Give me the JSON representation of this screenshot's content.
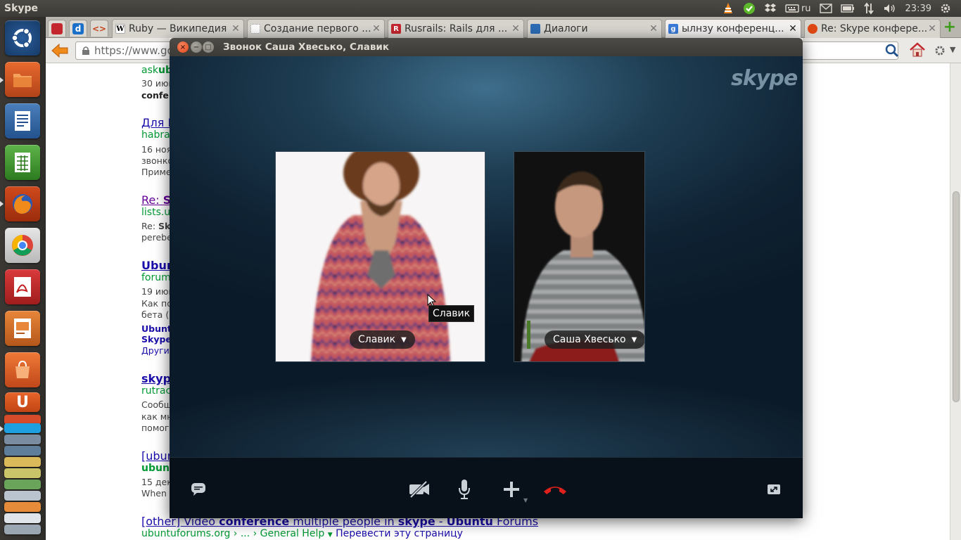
{
  "top_panel": {
    "app_title": "Skype",
    "keyboard_layout": "ru",
    "clock": "23:39"
  },
  "browser": {
    "tabs": [
      {
        "label": "Ruby — Википедия",
        "favicon": "wikipedia-icon"
      },
      {
        "label": "Создание первого ...",
        "favicon": "page-icon"
      },
      {
        "label": "Rusrails: Rails для ...",
        "favicon": "rusrails-icon"
      },
      {
        "label": "Диалоги",
        "favicon": "dialog-icon"
      },
      {
        "label": "ылнзу конференц...",
        "favicon": "google-icon",
        "active": true
      },
      {
        "label": "Re: Skype конфере...",
        "favicon": "ubuntu-icon"
      }
    ],
    "url": "https://www.goo"
  },
  "results": [
    {
      "title": "",
      "url_pre": "ask",
      "url_bold": "ub",
      "snippet": [
        "30 июн",
        "confe"
      ]
    },
    {
      "title": "Для L",
      "url": "habrah",
      "snippet": [
        "16 ноя",
        "звонко",
        "Приме"
      ]
    },
    {
      "title_pre": "Re: ",
      "title_bold": "S",
      "url": "lists.ub",
      "snippet_pre": "Re: ",
      "snippet_bold": "Sk",
      "snippet2": "perebe"
    },
    {
      "title": "Ubun",
      "url": "forum.",
      "snippet": [
        "19 июн",
        "Как по",
        "бета (2"
      ],
      "sub": [
        "Ubuntu",
        "Skype"
      ],
      "sub_link": "Другие"
    },
    {
      "title": "skype",
      "url": "rutrack",
      "snippet": [
        "Сообщ",
        "как мн",
        "помоги"
      ]
    },
    {
      "title": "[ubun",
      "url": "ubunt",
      "snippet": [
        "15 дек",
        "When s"
      ]
    },
    {
      "title_parts": [
        "[other] Video ",
        "conference",
        " multiple people in ",
        "skype",
        " - ",
        "Ubuntu",
        " Forums"
      ],
      "url": "ubuntuforums.org › ... › General Help",
      "translate": "Перевести эту страницу"
    }
  ],
  "skype": {
    "window_title": "Звонок Саша Хвесько, Славик",
    "logo": "skype",
    "participants": [
      {
        "name": "Славик",
        "dropdown": "▼"
      },
      {
        "name": "Саша Хвесько",
        "dropdown": "▼"
      }
    ],
    "tooltip": "Славик"
  },
  "colors": {
    "hangup": "#e0211b",
    "panel": "#3c3b37",
    "call_bg": "#0f2233"
  }
}
